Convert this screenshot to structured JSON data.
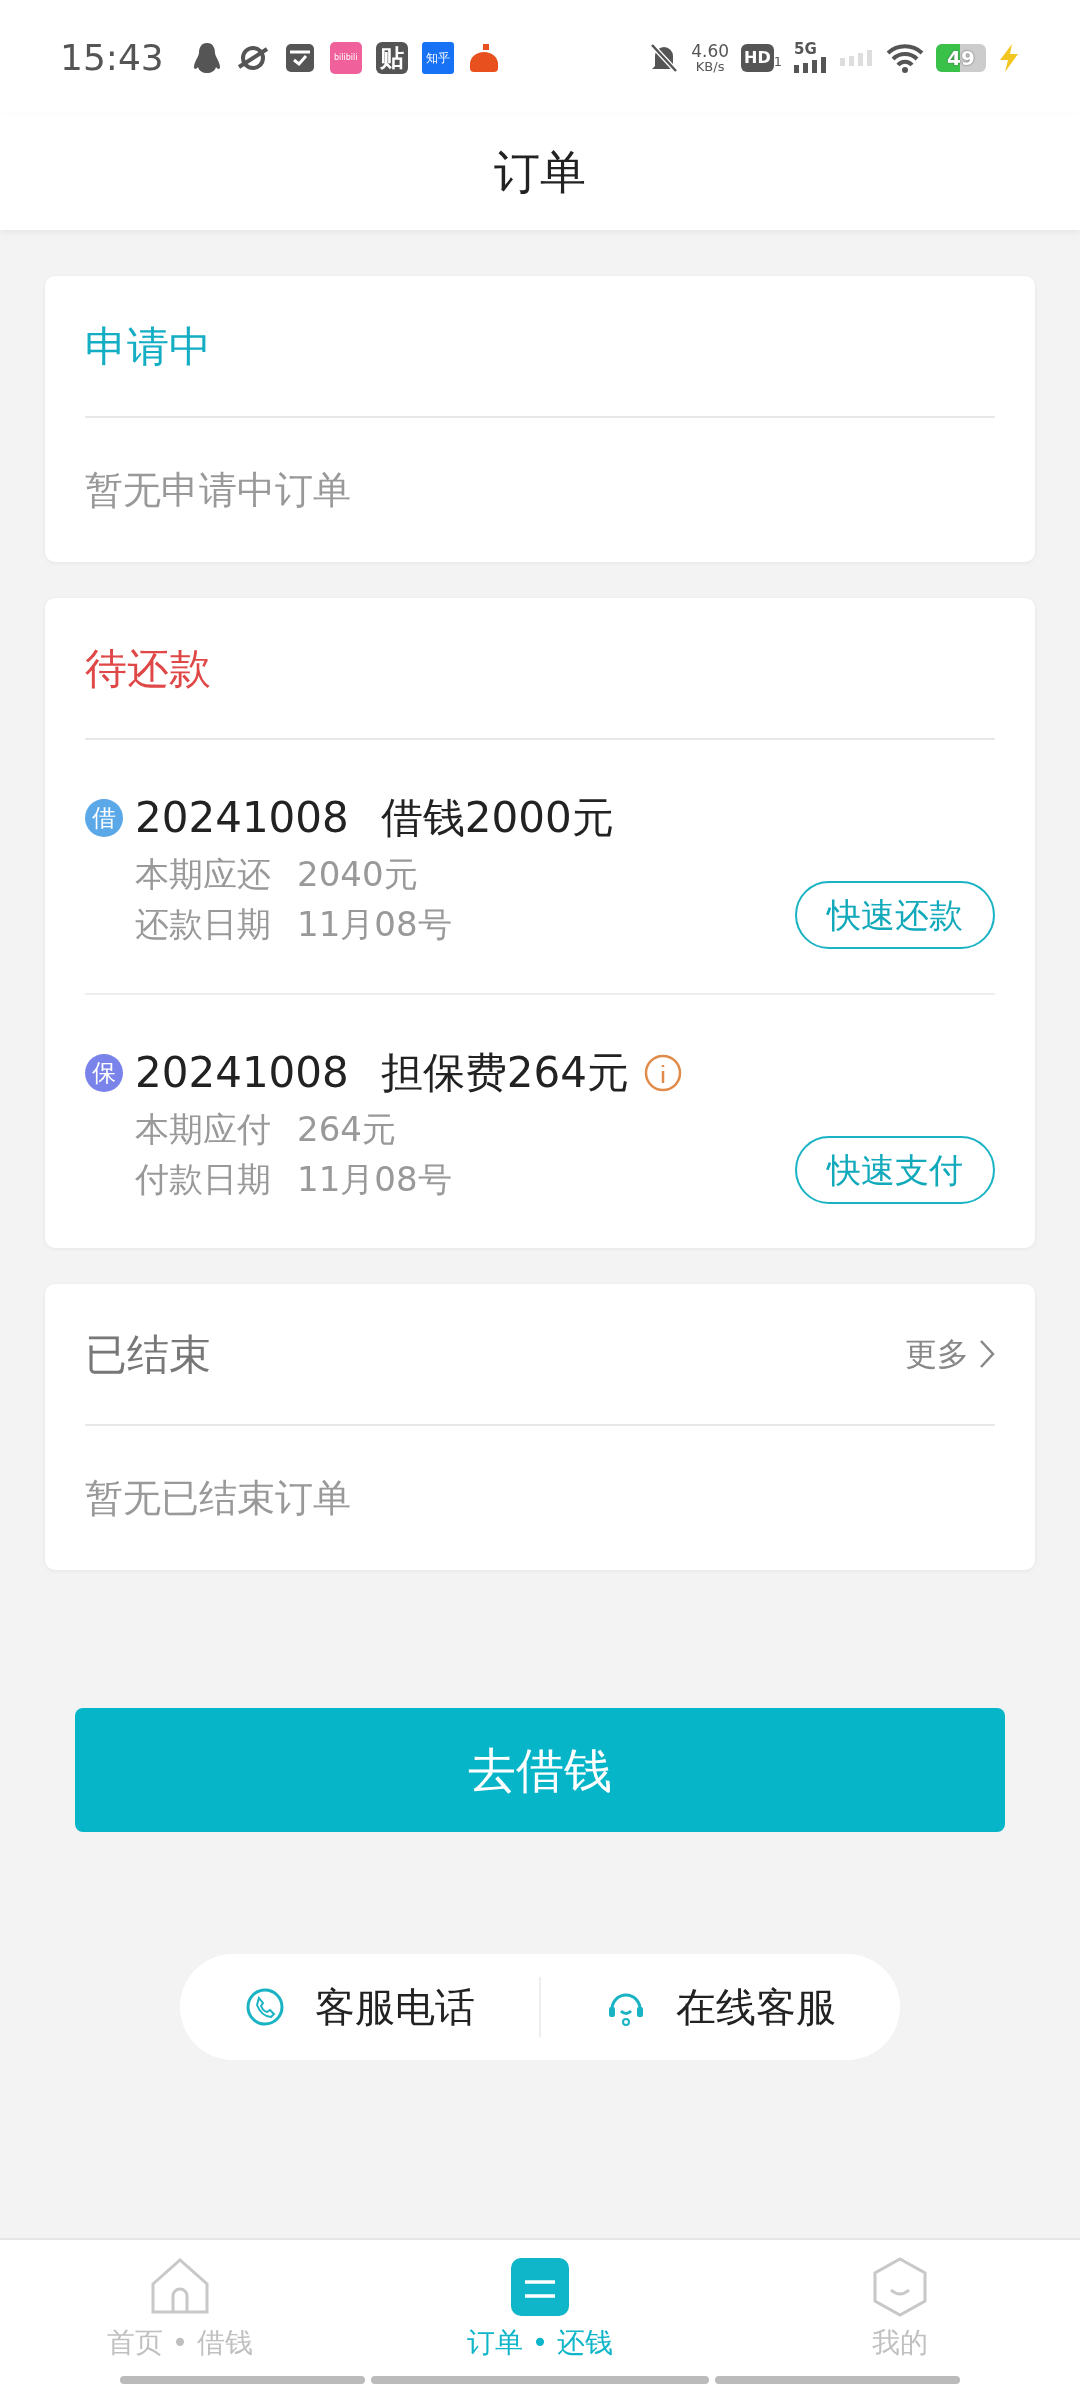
{
  "status_bar": {
    "time": "15:43",
    "apps": [
      {
        "kind": "penguin"
      },
      {
        "kind": "planet"
      },
      {
        "kind": "box"
      },
      {
        "kind": "pink",
        "label": "bilibili"
      },
      {
        "kind": "dark",
        "label": "贴"
      },
      {
        "kind": "blue",
        "label": "知乎"
      },
      {
        "kind": "orange"
      }
    ],
    "speed": "4.60",
    "speed_unit": "KB/s",
    "hd": "HD",
    "hd_sub": "1",
    "network": "5G",
    "battery": "49"
  },
  "header": {
    "title": "订单"
  },
  "sections": [
    {
      "title": "申请中",
      "color": "#13aec4",
      "empty_text": "暂无申请中订单"
    },
    {
      "title": "待还款",
      "color": "#e04747",
      "items": [
        {
          "badge": "借",
          "color": "#5aa8e8",
          "order_no": "20241008",
          "title": "借钱2000元",
          "info": false,
          "lines": [
            {
              "label": "本期应还",
              "value": "2040元"
            },
            {
              "label": "还款日期",
              "value": "11月08号"
            }
          ],
          "action": "快速还款"
        },
        {
          "badge": "保",
          "color": "#7a83ea",
          "order_no": "20241008",
          "title": "担保费264元",
          "info": true,
          "lines": [
            {
              "label": "本期应付",
              "value": "264元"
            },
            {
              "label": "付款日期",
              "value": "11月08号"
            }
          ],
          "action": "快速支付"
        }
      ]
    },
    {
      "title": "已结束",
      "color": "#777777",
      "more": "更多",
      "empty_text": "暂无已结束订单"
    }
  ],
  "primary_button": "去借钱",
  "contact": [
    {
      "kind": "phone",
      "label": "客服电话"
    },
    {
      "kind": "headset",
      "label": "在线客服"
    }
  ],
  "bottom_nav": [
    {
      "kind": "home",
      "label": "首页 • 借钱",
      "selected": false
    },
    {
      "kind": "list",
      "label": "订单 • 还钱",
      "selected": true
    },
    {
      "kind": "face",
      "label": "我的",
      "selected": false
    }
  ]
}
